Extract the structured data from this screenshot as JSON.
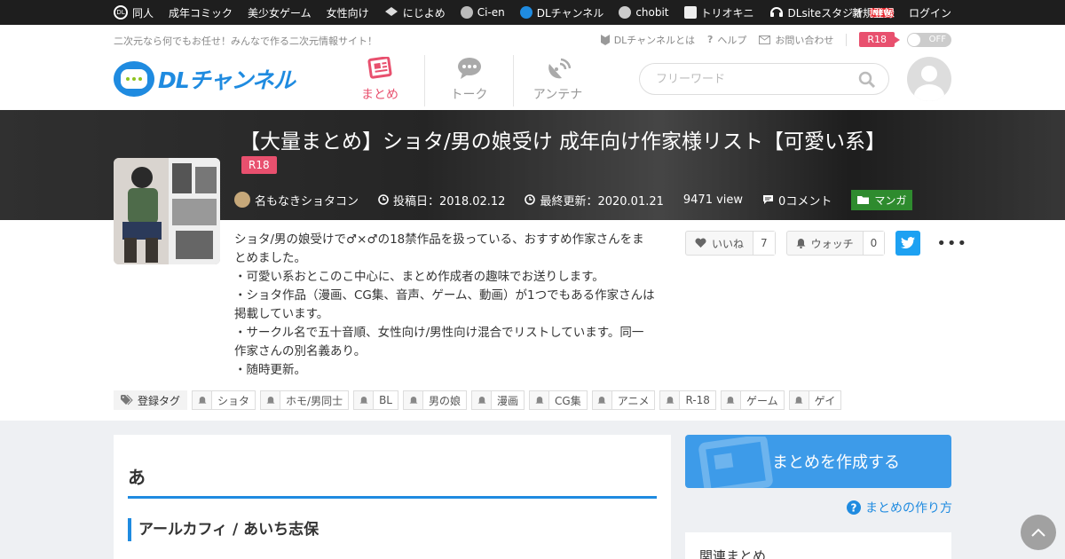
{
  "topbar": {
    "left_links": [
      {
        "label": "同人",
        "icon": "dl-icon"
      },
      {
        "label": "成年コミック"
      },
      {
        "label": "美少女ゲーム"
      },
      {
        "label": "女性向け"
      },
      {
        "label": "にじよめ",
        "icon": "nijiyome-icon"
      },
      {
        "label": "Ci-en",
        "icon": "ci-en-icon"
      },
      {
        "label": "DLチャンネル",
        "icon": "dlchannel-icon"
      },
      {
        "label": "chobit",
        "icon": "chobit-icon"
      },
      {
        "label": "トリオキニ",
        "icon": "triokini-icon"
      },
      {
        "label": "DLsiteスタジオ",
        "icon": "studio-icon",
        "badge": "NEW"
      }
    ],
    "register": "新規登録",
    "login": "ログイン"
  },
  "header": {
    "tagline": "二次元なら何でもお任せ！みんなで作る二次元情報サイト！",
    "links": {
      "about": "DLチャンネルとは",
      "help": "ヘルプ",
      "contact": "お問い合わせ"
    },
    "r18_label": "R18",
    "toggle_label": "OFF",
    "logo_text": "DLチャンネル",
    "tabs": [
      {
        "label": "まとめ",
        "active": true
      },
      {
        "label": "トーク",
        "active": false
      },
      {
        "label": "アンテナ",
        "active": false
      }
    ],
    "search_placeholder": "フリーワード"
  },
  "article": {
    "title": "【大量まとめ】ショタ/男の娘受け 成年向け作家様リスト【可愛い系】",
    "rating_badge": "R18",
    "author": "名もなきショタコン",
    "posted": "投稿日：2018.02.12",
    "updated": "最終更新：2020.01.21",
    "views": "9471 view",
    "comments": "0コメント",
    "category": "マンガ",
    "description": "ショタ/男の娘受けで♂×♂の18禁作品を扱っている、おすすめ作家さんをまとめました。\n・可愛い系おとこのこ中心に、まとめ作成者の趣味でお送りします。\n・ショタ作品（漫画、CG集、音声、ゲーム、動画）が1つでもある作家さんは掲載しています。\n・サークル名で五十音順、女性向け/男性向け混合でリストしています。同一作家さんの別名義あり。\n・随時更新。",
    "like_label": "いいね",
    "like_count": "7",
    "watch_label": "ウォッチ",
    "watch_count": "0",
    "tags_label": "登録タグ",
    "tags": [
      "ショタ",
      "ホモ/男同士",
      "BL",
      "男の娘",
      "漫画",
      "CG集",
      "アニメ",
      "R-18",
      "ゲーム",
      "ゲイ"
    ]
  },
  "content": {
    "section_heading": "あ",
    "sub_heading": "アールカフィ / あいち志保"
  },
  "sidebar": {
    "create_button": "まとめを作成する",
    "howto_link": "まとめの作り方",
    "related_heading": "関連まとめ"
  },
  "colors": {
    "brand_blue": "#1f8be0",
    "r18_pink": "#e8506e",
    "category_green": "#2e8b2e",
    "twitter_blue": "#1da1f2"
  }
}
